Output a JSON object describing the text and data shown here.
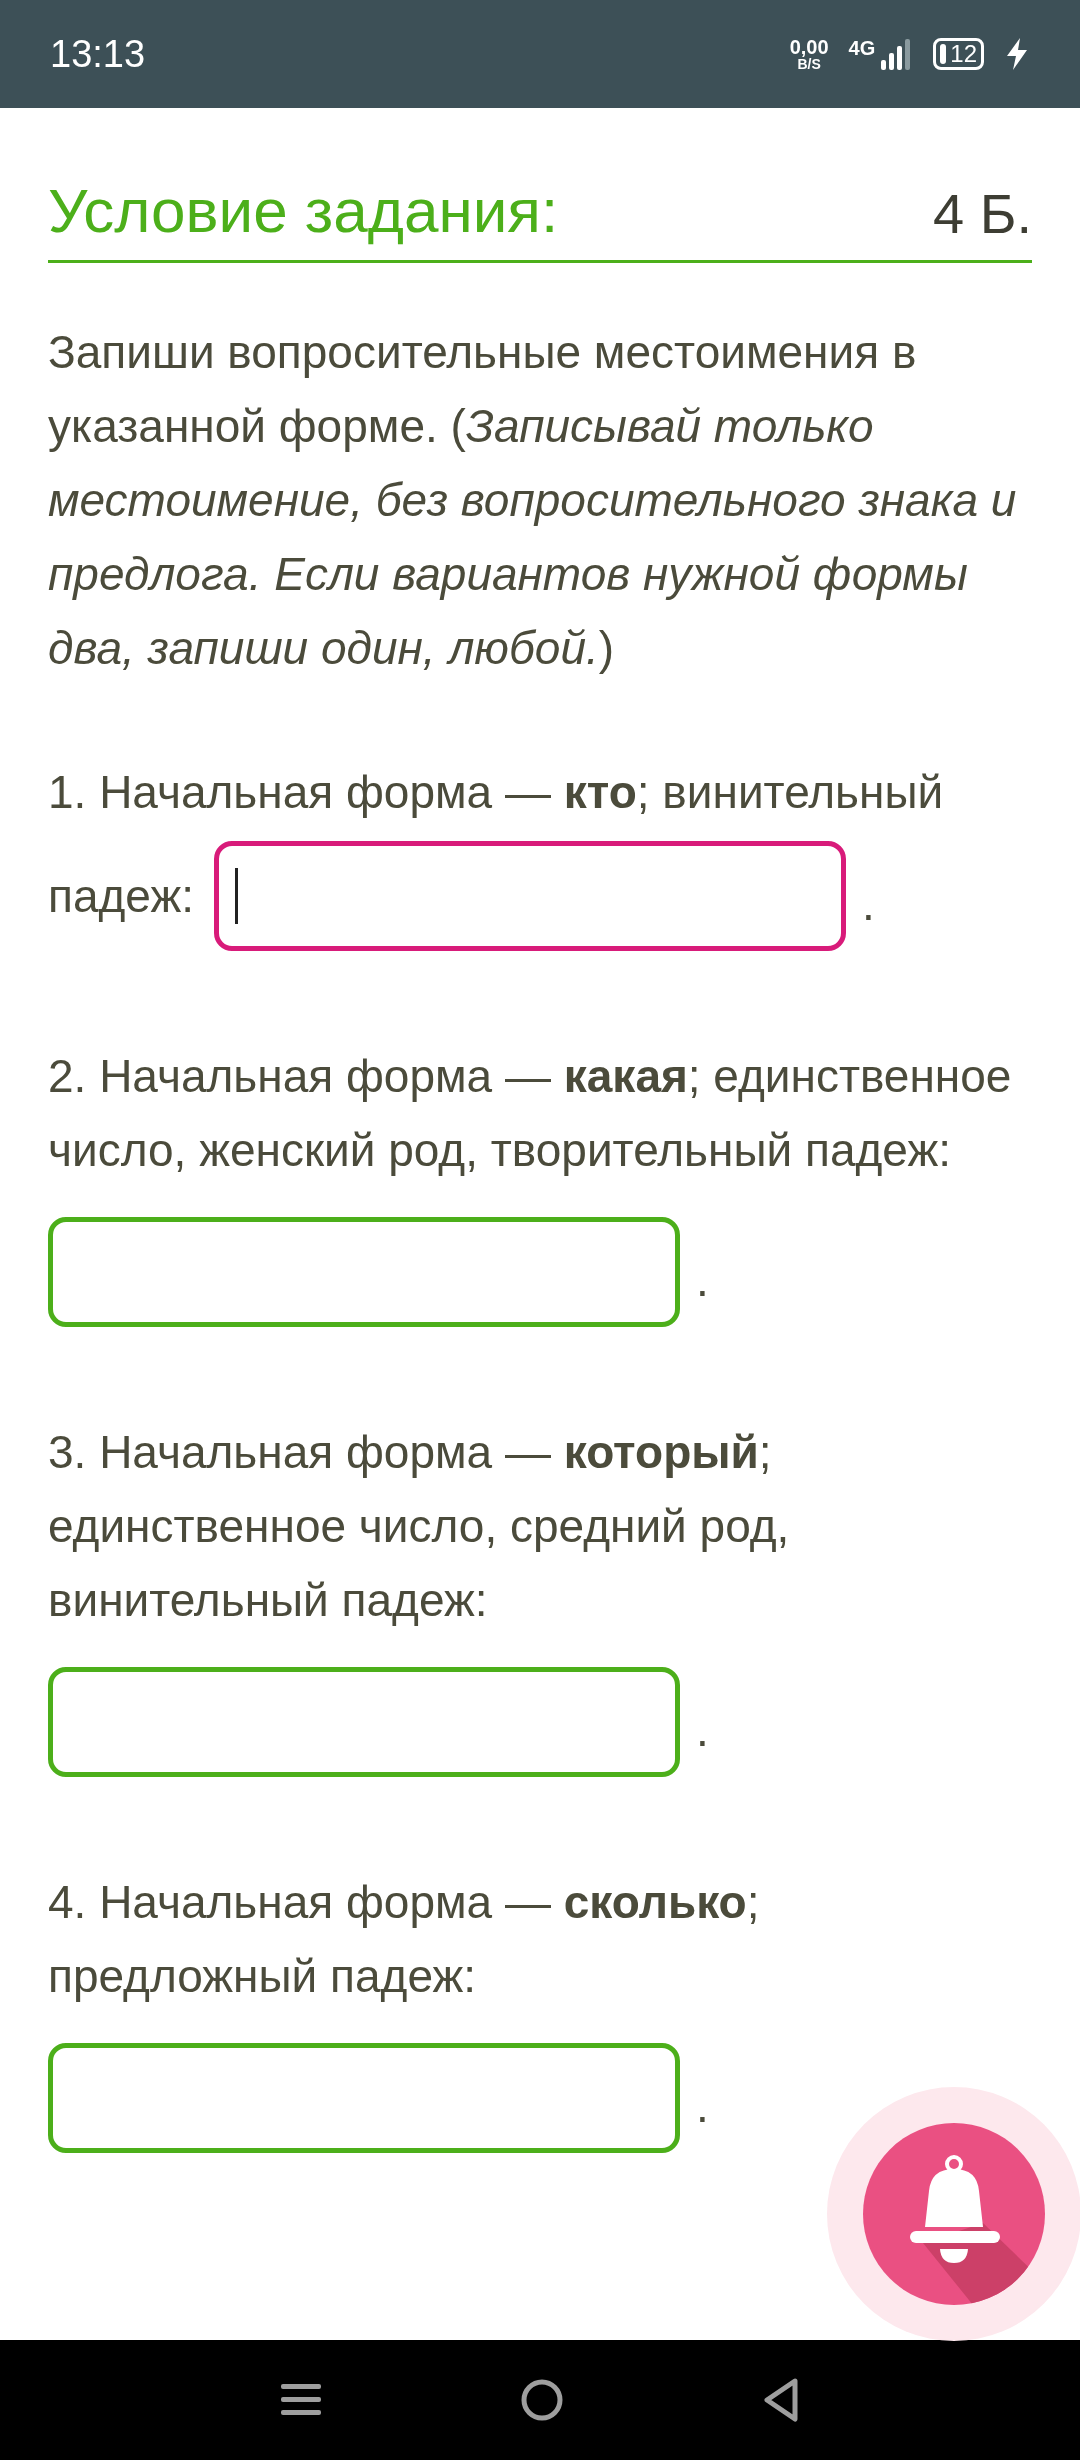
{
  "status_bar": {
    "time": "13:13",
    "speed": "0,00",
    "speed_unit": "B/S",
    "network": "4G",
    "battery": "12",
    "charging": true
  },
  "header": {
    "title": "Условие задания:",
    "points": "4 Б."
  },
  "instruction": "Запиши вопросительные местоимения в указанной форме. (*Записывай только местоимение, без вопросительного знака и предлога. Если вариантов нужной формы два, запиши один, любой.*)",
  "items": [
    {
      "text": "1. Начальная форма — **кто**; винительный",
      "label": "падеж:",
      "kind": "inline",
      "focused": true,
      "suffix": "."
    },
    {
      "text": "2. Начальная форма — **какая**; единственное число, женский род, творительный падеж:",
      "kind": "block",
      "focused": false,
      "suffix": "."
    },
    {
      "text": "3. Начальная форма — **который**; единственное число, средний род, винительный падеж:",
      "kind": "block",
      "focused": false,
      "suffix": "."
    },
    {
      "text": "4. Начальная форма — **сколько**; предложный падеж:",
      "kind": "block",
      "focused": false,
      "suffix": "."
    }
  ]
}
